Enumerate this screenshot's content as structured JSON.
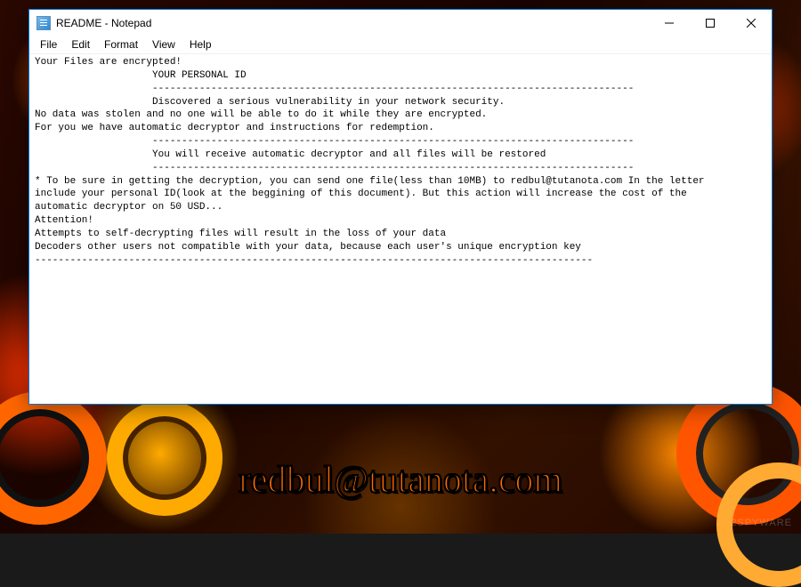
{
  "window": {
    "title": "README - Notepad"
  },
  "menubar": {
    "items": [
      "File",
      "Edit",
      "Format",
      "View",
      "Help"
    ]
  },
  "content": {
    "text": "Your Files are encrypted!\n                    YOUR PERSONAL ID\n                    ----------------------------------------------------------------------------------\n                    Discovered a serious vulnerability in your network security.\nNo data was stolen and no one will be able to do it while they are encrypted.\nFor you we have automatic decryptor and instructions for redemption.\n                    ----------------------------------------------------------------------------------\n                    You will receive automatic decryptor and all files will be restored\n                    ----------------------------------------------------------------------------------\n* To be sure in getting the decryption, you can send one file(less than 10MB) to redbul@tutanota.com In the letter\ninclude your personal ID(look at the beggining of this document). But this action will increase the cost of the\nautomatic decryptor on 50 USD...\nAttention!\nAttempts to self-decrypting files will result in the loss of your data\nDecoders other users not compatible with your data, because each user's unique encryption key\n-----------------------------------------------------------------------------------------------"
  },
  "overlay": {
    "email": "redbul@tutanota.com"
  },
  "watermark": {
    "text": "2SPYWARE"
  }
}
